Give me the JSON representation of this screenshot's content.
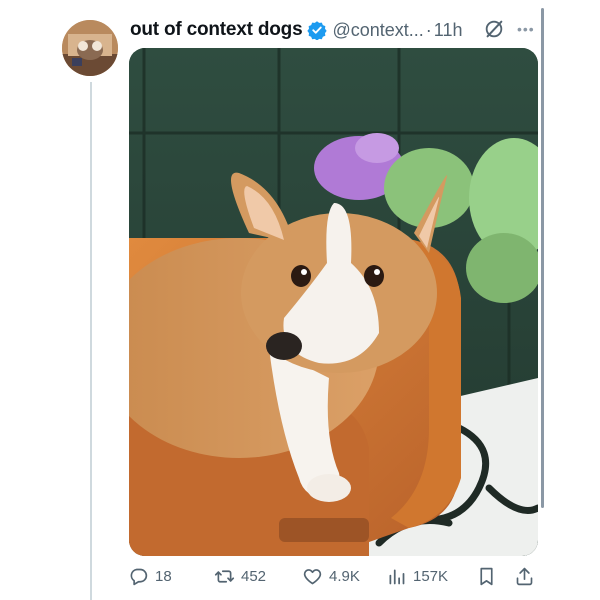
{
  "post": {
    "display_name": "out of context dogs",
    "handle": "@context...",
    "separator": "·",
    "timestamp": "11h",
    "verified": true,
    "media_alt_subject": "corgi on an orange pet couch",
    "icons": {
      "verified": "verified-badge-icon",
      "grok": "grok-icon",
      "more": "more-options-icon"
    }
  },
  "actions": {
    "replies": "18",
    "reposts": "452",
    "likes": "4.9K",
    "views": "157K"
  },
  "colors": {
    "verified_blue": "#1d9bf0",
    "secondary_text": "#536471",
    "primary_text": "#0f1419"
  }
}
